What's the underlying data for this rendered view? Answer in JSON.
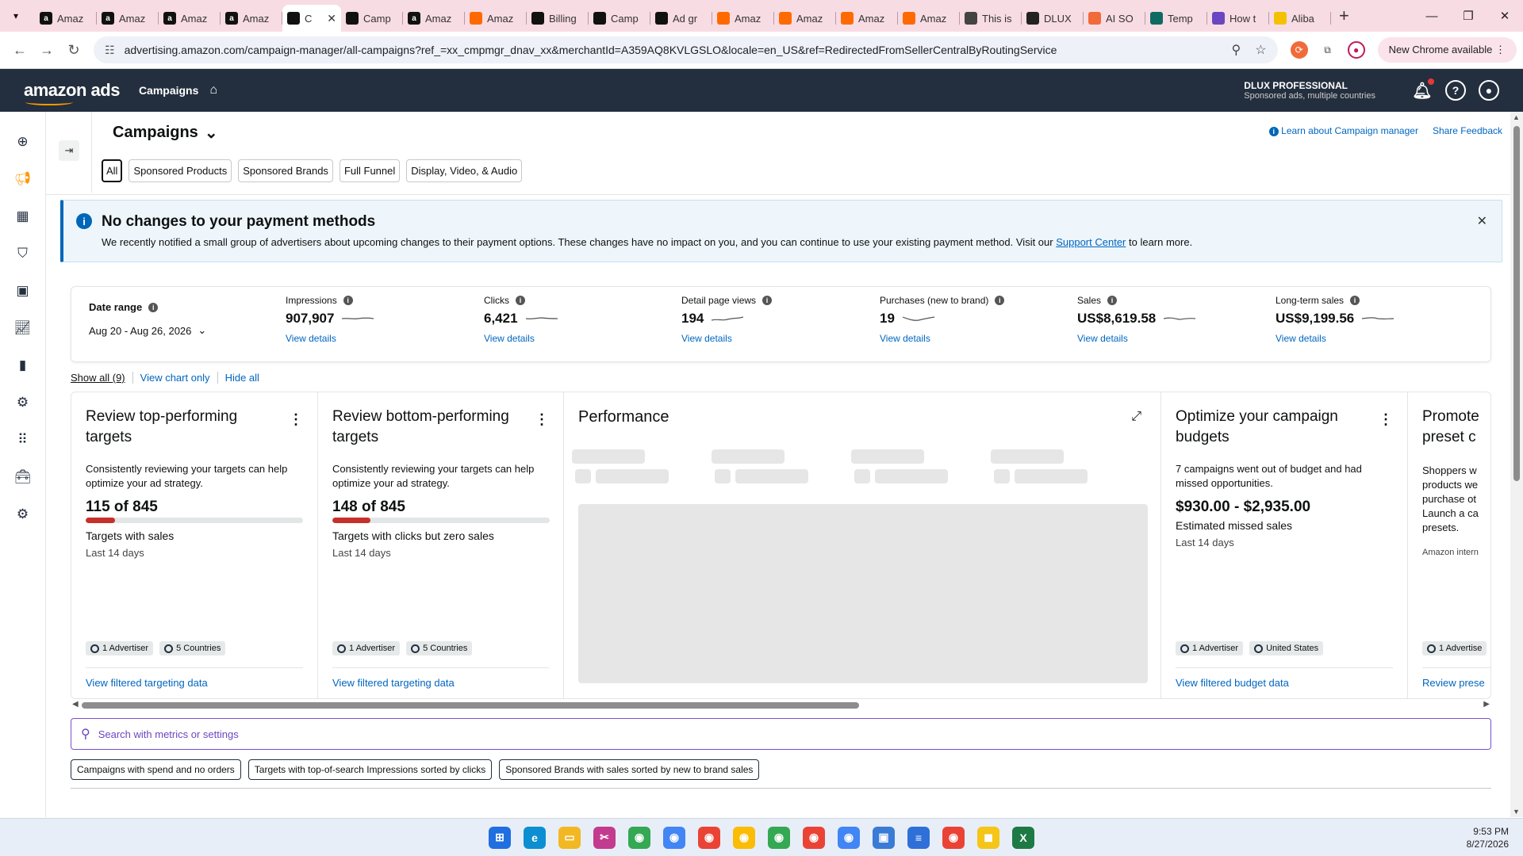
{
  "browser": {
    "tabs": [
      {
        "label": "Amaz",
        "fav": "a",
        "color": "#111111"
      },
      {
        "label": "Amaz",
        "fav": "a",
        "color": "#111111"
      },
      {
        "label": "Amaz",
        "fav": "a",
        "color": "#111111"
      },
      {
        "label": "Amaz",
        "fav": "a",
        "color": "#111111"
      },
      {
        "label": "C",
        "fav": "",
        "color": "#111111",
        "active": true
      },
      {
        "label": "Camp",
        "fav": "",
        "color": "#111111"
      },
      {
        "label": "Amaz",
        "fav": "a",
        "color": "#111111"
      },
      {
        "label": "Amaz",
        "fav": "",
        "color": "#ff6a00"
      },
      {
        "label": "Billing",
        "fav": "",
        "color": "#111111"
      },
      {
        "label": "Camp",
        "fav": "",
        "color": "#111111"
      },
      {
        "label": "Ad gr",
        "fav": "",
        "color": "#111111"
      },
      {
        "label": "Amaz",
        "fav": "",
        "color": "#ff6a00"
      },
      {
        "label": "Amaz",
        "fav": "",
        "color": "#ff6a00"
      },
      {
        "label": "Amaz",
        "fav": "",
        "color": "#ff6a00"
      },
      {
        "label": "Amaz",
        "fav": "",
        "color": "#ff6a00"
      },
      {
        "label": "This is",
        "fav": "",
        "color": "#444444"
      },
      {
        "label": "DLUX",
        "fav": "",
        "color": "#222222"
      },
      {
        "label": "AI SO",
        "fav": "",
        "color": "#f06a3a"
      },
      {
        "label": "Temp",
        "fav": "",
        "color": "#0e6b62"
      },
      {
        "label": "How t",
        "fav": "",
        "color": "#6b46c1"
      },
      {
        "label": "Aliba",
        "fav": "",
        "color": "#f2c200"
      }
    ],
    "url": "advertising.amazon.com/campaign-manager/all-campaigns?ref_=xx_cmpmgr_dnav_xx&merchantId=A359AQ8KVLGSLO&locale=en_US&ref=RedirectedFromSellerCentralByRoutingService",
    "new_chrome": "New Chrome available"
  },
  "topbar": {
    "logo": "amazon ads",
    "nav": "Campaigns",
    "account_name": "DLUX PROFESSIONAL",
    "account_sub": "Sponsored ads, multiple countries"
  },
  "header": {
    "title": "Campaigns",
    "learn_link": "Learn about Campaign manager",
    "feedback_link": "Share Feedback"
  },
  "chips": [
    "All",
    "Sponsored Products",
    "Sponsored Brands",
    "Full Funnel",
    "Display, Video, & Audio"
  ],
  "banner": {
    "title": "No changes to your payment methods",
    "desc": "We recently notified a small group of advertisers about upcoming changes to their payment options. These changes have no impact on you, and you can continue to use your existing payment method. Visit our ",
    "link": "Support Center",
    "desc_end": " to learn more."
  },
  "date_range": {
    "label": "Date range",
    "value": "Aug 20 - Aug 26, 2026"
  },
  "metrics": [
    {
      "label": "Impressions",
      "value": "907,907",
      "link": "View details"
    },
    {
      "label": "Clicks",
      "value": "6,421",
      "link": "View details"
    },
    {
      "label": "Detail page views",
      "value": "194",
      "link": "View details"
    },
    {
      "label": "Purchases (new to brand)",
      "value": "19",
      "link": "View details"
    },
    {
      "label": "Sales",
      "value": "US$8,619.58",
      "link": "View details"
    },
    {
      "label": "Long-term sales",
      "value": "US$9,199.56",
      "link": "View details"
    }
  ],
  "show": {
    "all": "Show all (9)",
    "chart_only": "View chart only",
    "hide_all": "Hide all"
  },
  "cards": [
    {
      "title": "Review top-performing targets",
      "desc": "Consistently reviewing your targets can help optimize your ad strategy.",
      "value": "115 of 845",
      "progress": 0.136,
      "sub": "Targets with sales",
      "period": "Last 14 days",
      "tags": [
        "1 Advertiser",
        "5 Countries"
      ],
      "link": "View filtered targeting data"
    },
    {
      "title": "Review bottom-performing targets",
      "desc": "Consistently reviewing your targets can help optimize your ad strategy.",
      "value": "148 of 845",
      "progress": 0.175,
      "sub": "Targets with clicks but zero sales",
      "period": "Last 14 days",
      "tags": [
        "1 Advertiser",
        "5 Countries"
      ],
      "link": "View filtered targeting data"
    },
    {
      "title": "Optimize your campaign budgets",
      "desc": "7 campaigns went out of budget and had missed opportunities.",
      "value": "$930.00 - $2,935.00",
      "sub": "Estimated missed sales",
      "period": "Last 14 days",
      "tags": [
        "1 Advertiser",
        "United States"
      ],
      "link": "View filtered budget data"
    },
    {
      "title": "Promote preset c",
      "desc": "Shoppers w products we purchase ot Launch a ca presets.",
      "note": "Amazon intern",
      "tags": [
        "1 Advertise"
      ],
      "link": "Review prese"
    }
  ],
  "performance": {
    "title": "Performance"
  },
  "search": {
    "placeholder": "Search with metrics or settings"
  },
  "suggestions": [
    "Campaigns with spend and no orders",
    "Targets with top-of-search Impressions sorted by clicks",
    "Sponsored Brands with sales sorted by new to brand sales"
  ],
  "taskbar": {
    "time": "9:53 PM",
    "date": "8/27/2026",
    "apps": [
      {
        "name": "windows-start-icon",
        "color": "#1f6fe0"
      },
      {
        "name": "edge-icon",
        "color": "#0c8fd1"
      },
      {
        "name": "file-explorer-icon",
        "color": "#f2b824"
      },
      {
        "name": "snipping-tool-icon",
        "color": "#c33b8e"
      },
      {
        "name": "chrome-icon",
        "color": "#34a853"
      },
      {
        "name": "chrome-icon",
        "color": "#4285f4"
      },
      {
        "name": "chrome-icon",
        "color": "#ea4335"
      },
      {
        "name": "chrome-icon",
        "color": "#fbbc05"
      },
      {
        "name": "chrome-icon",
        "color": "#34a853"
      },
      {
        "name": "chrome-icon",
        "color": "#ea4335"
      },
      {
        "name": "chrome-icon",
        "color": "#4285f4"
      },
      {
        "name": "screen-app-icon",
        "color": "#3a7bd5"
      },
      {
        "name": "notepad-icon",
        "color": "#2f6fd8"
      },
      {
        "name": "chrome-icon",
        "color": "#ea4335"
      },
      {
        "name": "chat-icon",
        "color": "#f5c518"
      },
      {
        "name": "excel-icon",
        "color": "#1d7a45"
      }
    ]
  }
}
